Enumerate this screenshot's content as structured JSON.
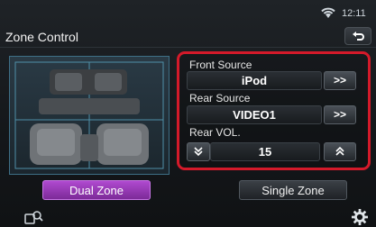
{
  "status": {
    "time": "12:11",
    "wifi_icon": "wifi-icon"
  },
  "screen": {
    "title": "Zone Control"
  },
  "controls": {
    "front_source_label": "Front Source",
    "front_source_value": "iPod",
    "front_next_label": ">>",
    "rear_source_label": "Rear Source",
    "rear_source_value": "VIDEO1",
    "rear_next_label": ">>",
    "rear_vol_label": "Rear VOL.",
    "rear_vol_value": "15"
  },
  "zones": {
    "dual_label": "Dual Zone",
    "single_label": "Single Zone",
    "dual_active": true
  },
  "colors": {
    "highlight_border": "#d41a2a",
    "dual_button": "#a043c4",
    "accent_blue": "#3e6f86"
  },
  "icons": [
    "wifi-icon",
    "back-icon",
    "car-seats-icon",
    "chevron-down-icon",
    "chevron-up-icon",
    "search-icon",
    "gear-icon"
  ]
}
